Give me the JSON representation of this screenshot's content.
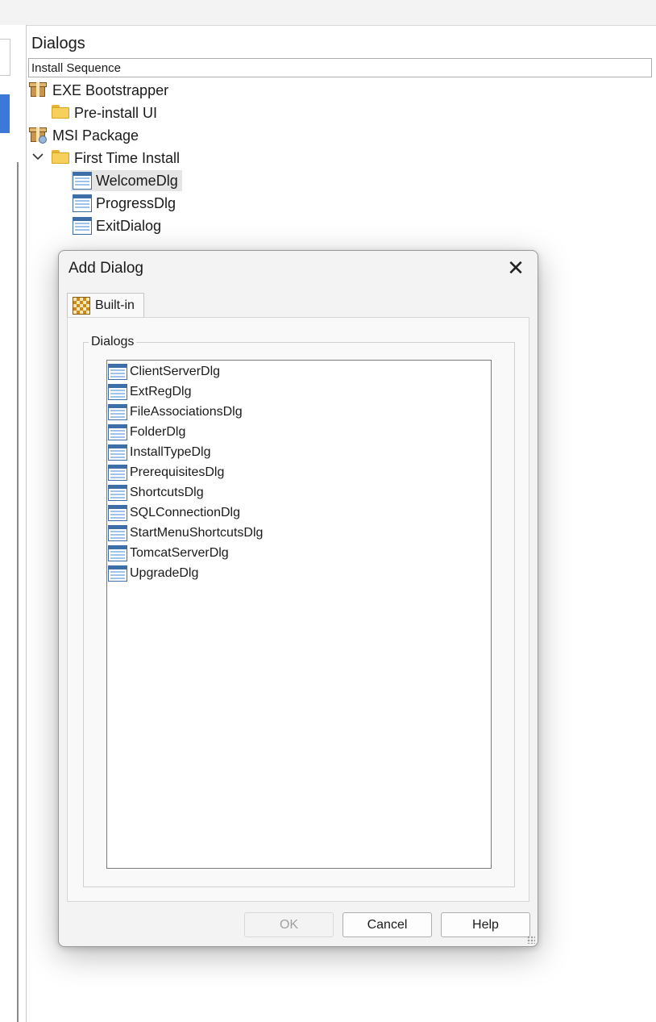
{
  "panel": {
    "title": "Dialogs",
    "sequence_header": "Install Sequence"
  },
  "tree": {
    "exe_bootstrapper": "EXE Bootstrapper",
    "pre_install_ui": "Pre-install UI",
    "msi_package": "MSI Package",
    "first_time_install": "First Time Install",
    "welcome_dlg": "WelcomeDlg",
    "progress_dlg": "ProgressDlg",
    "exit_dialog": "ExitDialog"
  },
  "dialog": {
    "title": "Add Dialog",
    "close": "✕",
    "tab_label": "Built-in",
    "group_label": "Dialogs",
    "items": [
      "ClientServerDlg",
      "ExtRegDlg",
      "FileAssociationsDlg",
      "FolderDlg",
      "InstallTypeDlg",
      "PrerequisitesDlg",
      "ShortcutsDlg",
      "SQLConnectionDlg",
      "StartMenuShortcutsDlg",
      "TomcatServerDlg",
      "UpgradeDlg"
    ],
    "ok_label": "OK",
    "cancel_label": "Cancel",
    "help_label": "Help"
  }
}
